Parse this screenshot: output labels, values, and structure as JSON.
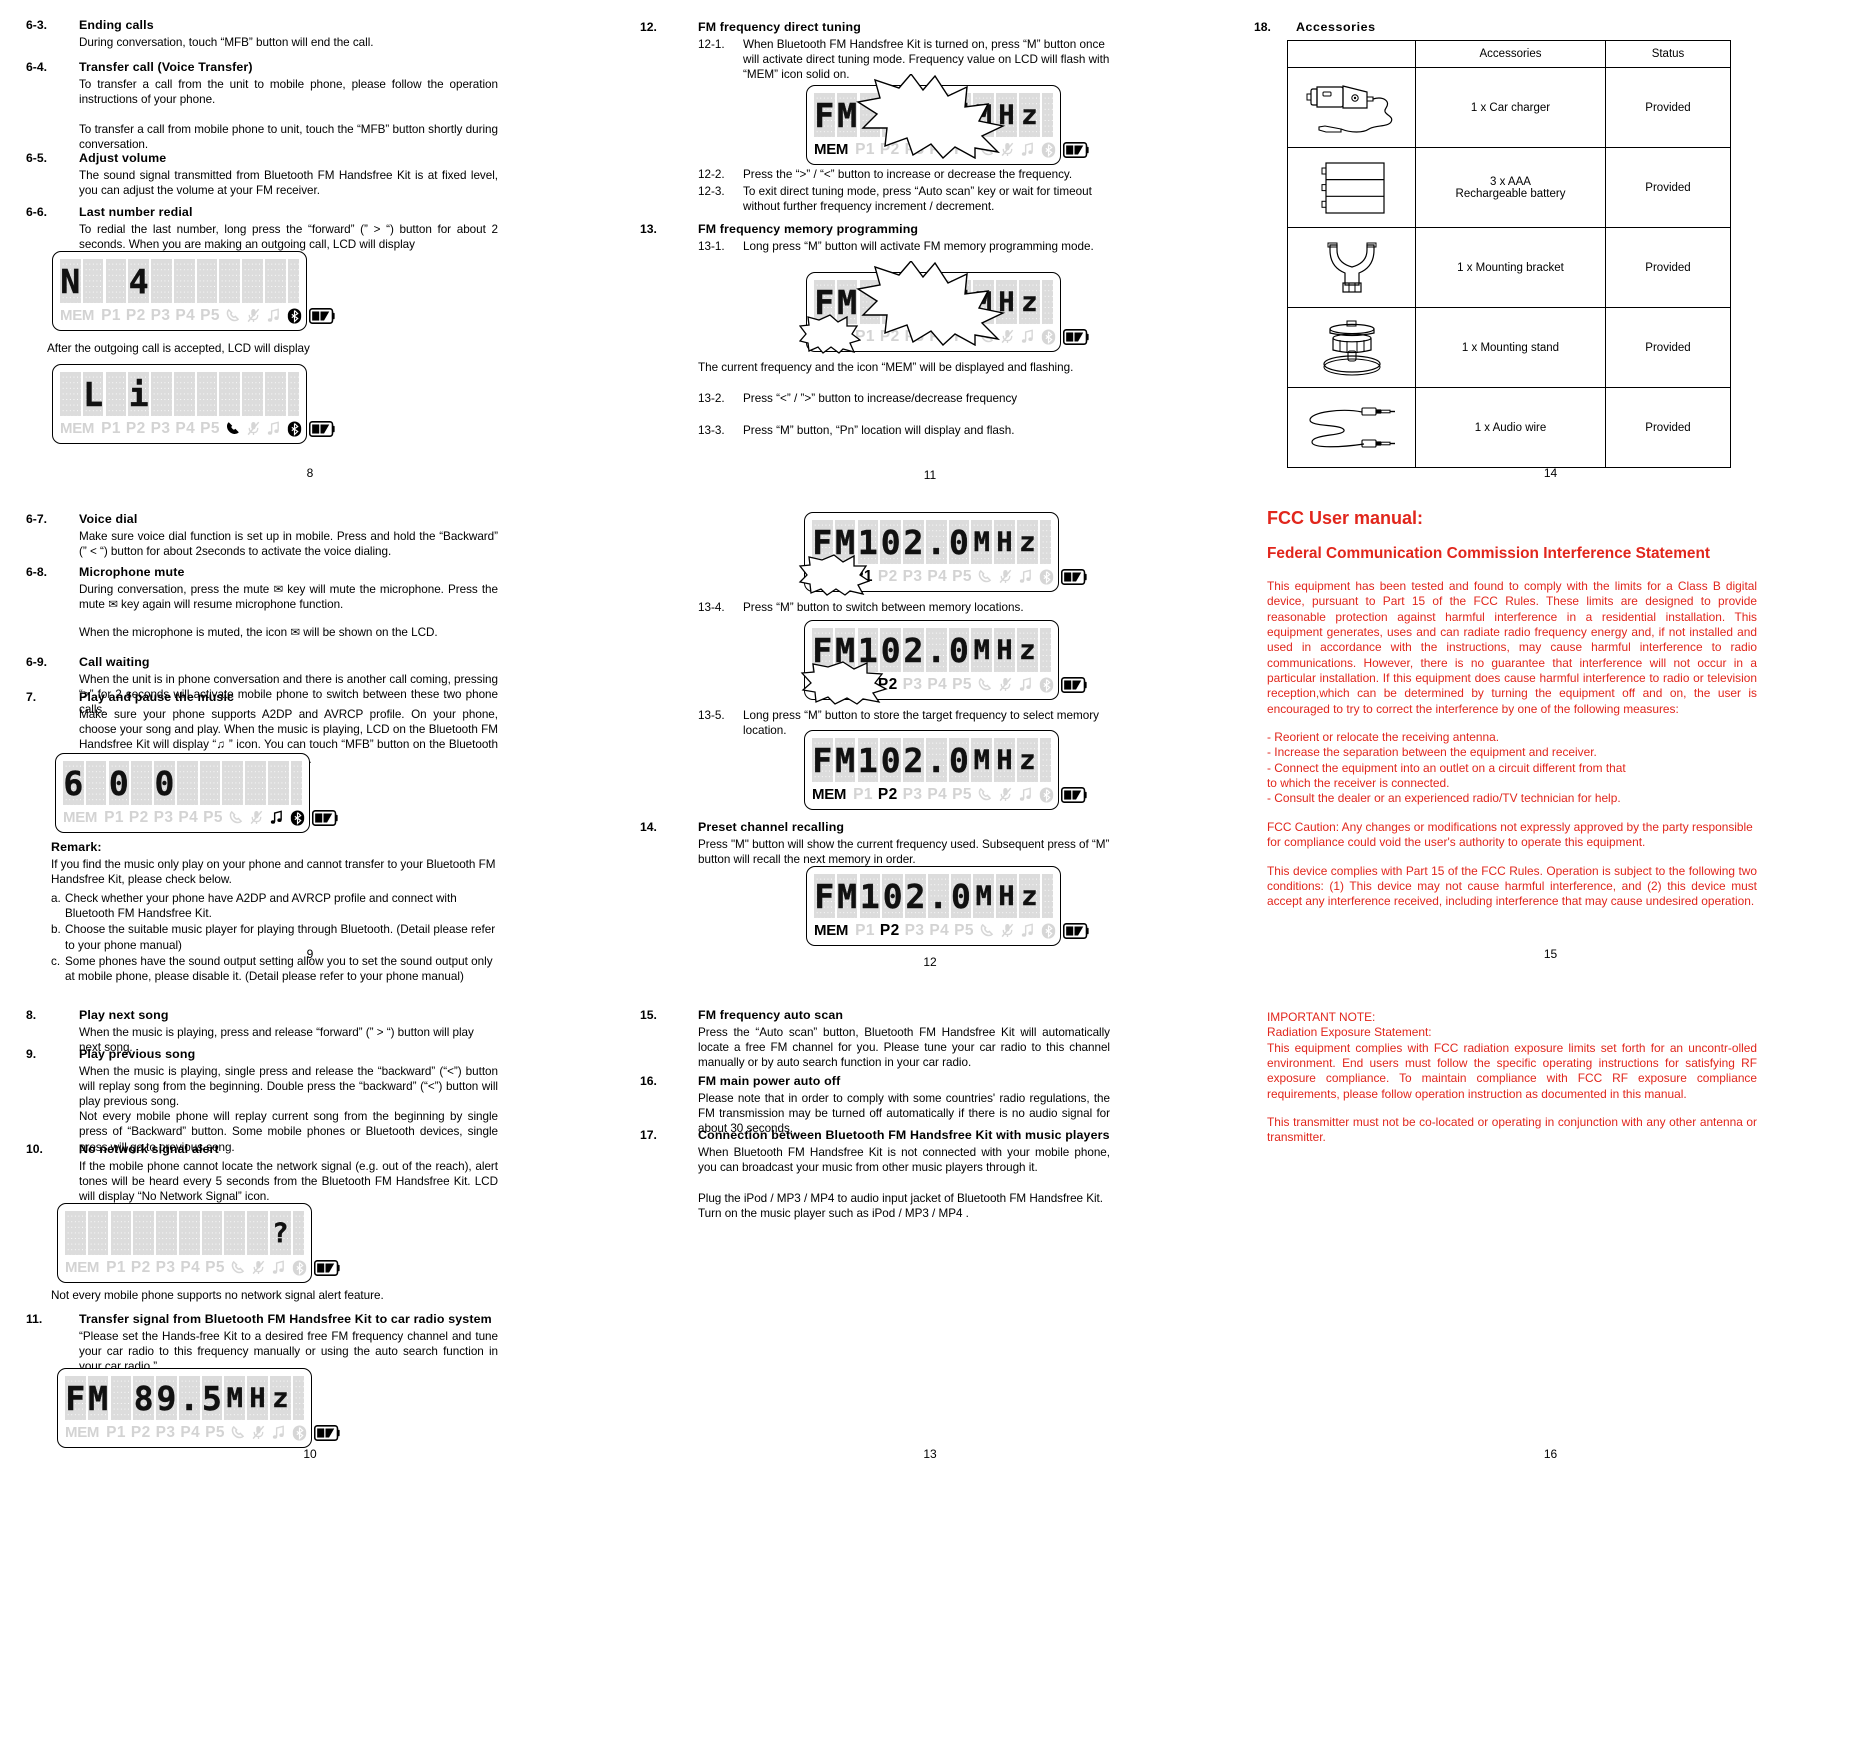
{
  "column1": {
    "sections": [
      {
        "number": "6-3.",
        "title": "Ending calls",
        "paras": [
          "During conversation, touch “MFB” button will end the call."
        ]
      },
      {
        "number": "6-4.",
        "title": "Transfer call (Voice Transfer)",
        "paras": [
          "To transfer a call from the unit to mobile phone, please follow the operation instructions of your phone.",
          "To transfer a call from mobile phone to unit, touch the “MFB” button shortly during conversation."
        ]
      },
      {
        "number": "6-5.",
        "title": "Adjust volume",
        "paras": [
          "The sound signal transmitted from Bluetooth FM Handsfree Kit is at fixed level, you can adjust the volume at your FM receiver."
        ]
      },
      {
        "number": "6-6.",
        "title": "Last number redial",
        "paras": [
          "To redial the last number, long press the “forward” (” > “) button for about 2 seconds. When you are making an outgoing call, LCD will display"
        ],
        "after_lcd_text": "After the outgoing call is accepted, LCD will display"
      },
      {
        "number": "6-7.",
        "title": "Voice dial",
        "paras": [
          "Make sure voice dial function is set up in mobile.  Press and hold the “Backward” (” < “) button for about 2seconds to activate the voice dialing."
        ]
      },
      {
        "number": "6-8.",
        "title": "Microphone mute",
        "paras": [
          "During conversation, press the mute ✉ key will mute the microphone. Press the mute ✉ key again will resume microphone function.",
          "When the microphone is muted, the icon ✉ will be shown on the LCD."
        ]
      },
      {
        "number": "6-9.",
        "title": "Call waiting",
        "paras": [
          "When the unit is in phone conversation and there is another call coming, pressing “>” for 2 seconds will activate mobile phone to switch between these two phone calls."
        ]
      },
      {
        "number": "7.",
        "title": "Play and pause the music",
        "paras": [
          "Make sure your phone supports A2DP and AVRCP profile. On your phone, choose your song and play. When the music is playing, LCD on the Bluetooth FM Handsfree Kit will display “♫ ” icon. You can touch “MFB” button on the Bluetooth FM Handsfree Kit to pause or play the music."
        ],
        "remark_title": "Remark:",
        "remark_intro": "If you find the music only play on your phone and cannot transfer to your Bluetooth FM Handsfree Kit, please check below.",
        "remark_items": [
          {
            "key": "a.",
            "text": "Check whether your phone have A2DP and AVRCP profile and connect with Bluetooth FM Handsfree Kit."
          },
          {
            "key": "b.",
            "text": "Choose the suitable music player for playing through Bluetooth. (Detail please refer to your phone manual)"
          },
          {
            "key": "c.",
            "text": "Some phones have the sound output setting allow you to set the sound output only at mobile phone, please disable it. (Detail please refer to your phone manual)"
          }
        ]
      },
      {
        "number": "8.",
        "title": "Play next song",
        "paras": [
          "When the music is playing, press and release “forward” (” > “) button will play next song."
        ]
      },
      {
        "number": "9.",
        "title": "Play previous song",
        "paras": [
          "When  the music is playing, single  press  and  release  the “backward” (“<”)  button  will replay  song  from  the  beginning.  Double  press  the “backward” (“<”)  button  will  play previous song.",
          "Not  every mobile  phone will  replay  current song from the beginning by single press of “Backward” button.  Some mobile phones  or Bluetooth devices, single  press  will  go to previous song."
        ]
      },
      {
        "number": "10.",
        "title": "No network signal alert",
        "paras": [
          "If the mobile phone cannot locate the  network  signal (e.g. out of the reach), alert tones will be  heard  every 5 seconds  from  the Bluetooth  FM Handsfree Kit.  LCD will display “No Network Signal” icon."
        ],
        "after_lcd_text": "Not every mobile phone supports no network signal alert feature."
      },
      {
        "number": "11.",
        "title": "Transfer signal from Bluetooth FM Handsfree Kit to car radio system",
        "paras": [
          "“Please set the Hands-free Kit to a  desired free FM  frequency  channel  and  tune  your car radio to this frequency manually or using the auto search function in your car radio.”"
        ]
      }
    ],
    "page_numbers": [
      "8",
      "9",
      "10"
    ]
  },
  "column2": {
    "sections": [
      {
        "number": "12.",
        "title": "FM frequency direct tuning",
        "subs": [
          {
            "n": "12-1.",
            "t": "When Bluetooth FM Handsfree Kit is turned on, press “M” button once will activate direct tuning mode.  Frequency value on LCD will flash with “MEM” icon solid on."
          },
          {
            "n": "12-2.",
            "t": "Press the “>” / “<” button to increase or decrease the frequency."
          },
          {
            "n": "12-3.",
            "t": "To exit direct tuning mode, press “Auto scan” key or wait for timeout without further frequency increment / decrement."
          }
        ]
      },
      {
        "number": "13.",
        "title": "FM frequency memory programming",
        "subs": [
          {
            "n": "13-1.",
            "t": "Long press “M” button will activate FM memory programming mode."
          },
          {
            "n": "13-2.",
            "t": "Press “<” / ”>” button to increase/decrease frequency"
          },
          {
            "n": "13-3.",
            "t": "Press “M” button, “Pn” location will display and flash."
          },
          {
            "n": "13-4.",
            "t": "Press “M” button to switch between memory locations."
          },
          {
            "n": "13-5.",
            "t": "Long press “M” button to store the target frequency to select memory location."
          }
        ],
        "note": "The current frequency and the icon “MEM” will be displayed and flashing."
      },
      {
        "number": "14.",
        "title": "Preset channel recalling",
        "paras": [
          "Press \"M\" button will show the current frequency used. Subsequent press of  “M” button will recall the next memory in order."
        ]
      },
      {
        "number": "15.",
        "title": "FM frequency auto scan",
        "paras": [
          "Press the “Auto scan” button, Bluetooth FM Handsfree Kit will automatically locate a free FM  channel  for  you.  Please  tune  your  car  radio  to  this  channel  manually  or  by  auto search function in your car radio."
        ]
      },
      {
        "number": "16.",
        "title": "FM main power auto off",
        "paras": [
          "Please  note  that  in  order  to  comply  with  some  countries'  radio  regulations,  the  FM transmission  may  be  turned  off  automatically  if  there  is  no  audio  signal  for  about  30 seconds."
        ]
      },
      {
        "number": "17.",
        "title": "Connection between Bluetooth FM Handsfree Kit with music players",
        "paras": [
          "When  Bluetooth  FM  Handsfree  Kit  is  not  connected  with  your  mobile  phone,  you  can broadcast your music from other music players through it.",
          "Plug the iPod / MP3 / MP4 to audio input jacket of Bluetooth FM Handsfree Kit.\nTurn on the music player such as iPod / MP3 / MP4 ."
        ]
      }
    ],
    "page_numbers": [
      "11",
      "12",
      "13"
    ]
  },
  "column3": {
    "accessories_section": {
      "number": "18.",
      "title": "Accessories",
      "headers": [
        "",
        "Accessories",
        "Status"
      ],
      "rows": [
        {
          "icon": "car-charger-icon",
          "name": "1 x Car charger",
          "status": "Provided"
        },
        {
          "icon": "aaa-battery-icon",
          "name": "3 x AAA\nRechargeable battery",
          "status": "Provided"
        },
        {
          "icon": "mounting-bracket-icon",
          "name": "1 x Mounting bracket",
          "status": "Provided"
        },
        {
          "icon": "mounting-stand-icon",
          "name": "1 x Mounting stand",
          "status": "Provided"
        },
        {
          "icon": "audio-wire-icon",
          "name": "1 x Audio wire",
          "status": "Provided"
        }
      ]
    },
    "fcc": {
      "title": "FCC User manual:",
      "subtitle": "Federal Communication Commission Interference Statement",
      "para1": "This  equipment  has  been  tested  and found  to comply  with  the  limits for a Class B digital  device,  pursuant  to Part 15  of the FCC Rules.  These  limits  are  designed  to provide reasonable protection  against  harmful interference in a residential installation. This  equipment generates, uses  and  can radiate  radio  frequency  energy and, if not installed and used in accordance with the instructions, may cause harmful interference to radio  communications.  However,  there is no  guarantee that  interference  will  not occur in a particular installation.  If this equipment does  cause harmful  interference to radio or television reception,which can be determined by turning the equipment off and on,  the user is encouraged to try to  correct the  interference  by  one  of the  following measures:",
      "bullets": [
        "- Reorient or relocate the receiving antenna.",
        "- Increase the separation between the equipment and receiver.",
        "- Connect the equipment into an outlet on a circuit different from that",
        "  to which the receiver is connected.",
        "- Consult the dealer or an experienced radio/TV technician for help."
      ],
      "caution": "FCC Caution: Any changes or modifications not expressly approved by the party responsible for compliance could void the user's authority to operate this equipment.",
      "compliance": "This  device  complies  with  Part  15  of  the FCC Rules.  Operation is  subject  to  the following two conditions: (1) This device may not  cause  harmful  interference, and (2) this  device must  accept  any  interference  received, including  interference that  may cause undesired operation.",
      "important_note_title": "IMPORTANT NOTE:",
      "radiation_title": "Radiation Exposure Statement:",
      "radiation_body": "This equipment complies  with FCC radiation exposure limits  set  forth for an uncontr-olled environment.  End  users  must follow   the   specific   operating   instructions  for satisfying  RF exposure compliance. To maintain  compliance  with  FCC RF  exposure compliance  requirements, please  follow  operation  instruction  as documented in this manual.",
      "transmitter": "This  transmitter  must  not be co-located  or operating in  conjunction  with  any  other antenna or transmitter.",
      "color": "#e1261c"
    },
    "page_numbers": [
      "14",
      "15",
      "16"
    ]
  },
  "lcd_displays": [
    {
      "id": "lcd-redial-dialing",
      "text": "N  4",
      "chars": [
        "N",
        "",
        "",
        "4",
        "",
        "",
        "",
        "",
        "",
        ""
      ],
      "mem_on": false,
      "presets_on": [],
      "icons_on": [
        "bluetooth"
      ],
      "battery": true
    },
    {
      "id": "lcd-call-accepted",
      "text": "L  i",
      "chars": [
        "",
        "L",
        "",
        "i",
        "",
        "",
        "",
        "",
        "",
        ""
      ],
      "mem_on": false,
      "presets_on": [],
      "icons_on": [
        "call",
        "bluetooth"
      ],
      "battery": true
    },
    {
      "id": "lcd-music-playing",
      "text": "6 0 0",
      "chars": [
        "6",
        "",
        "0",
        "",
        "0",
        "",
        "",
        "",
        "",
        ""
      ],
      "mem_on": false,
      "presets_on": [],
      "icons_on": [
        "music",
        "bluetooth"
      ],
      "battery": true
    },
    {
      "id": "lcd-no-network",
      "text": "?",
      "chars": [
        "",
        "",
        "",
        "",
        "",
        "",
        "",
        "",
        "",
        "?"
      ],
      "mem_on": false,
      "presets_on": [],
      "icons_on": [],
      "battery": true
    },
    {
      "id": "lcd-fm-89-5",
      "text": "FM  89.5MHz",
      "chars": [
        "F",
        "M",
        "",
        "8",
        "9",
        ".",
        "5",
        "M",
        "H",
        "z"
      ],
      "mem_on": false,
      "presets_on": [],
      "icons_on": [],
      "battery": true
    },
    {
      "id": "lcd-direct-tuning",
      "text": "FM  89.5MHz",
      "chars": [
        "F",
        "M",
        "",
        "8",
        "9",
        ".",
        "5",
        "M",
        "H",
        "z"
      ],
      "mem_on": true,
      "presets_on": [],
      "icons_on": [],
      "battery": true,
      "burst": "freq"
    },
    {
      "id": "lcd-memory-programming",
      "text": "FM  89.5MHz",
      "chars": [
        "F",
        "M",
        "",
        "8",
        "9",
        ".",
        "5",
        "M",
        "H",
        "z"
      ],
      "mem_on": true,
      "presets_on": [],
      "icons_on": [],
      "battery": true,
      "burst": "freq-mem"
    },
    {
      "id": "lcd-mem-p1-flash",
      "text": "FM 102.0MHz",
      "chars": [
        "F",
        "M",
        "1",
        "0",
        "2",
        ".",
        "0",
        "M",
        "H",
        "z"
      ],
      "mem_on": true,
      "presets_on": [
        "P1"
      ],
      "icons_on": [],
      "battery": true,
      "burst": "mem-p1"
    },
    {
      "id": "lcd-mem-p2-flash",
      "text": "FM 102.0MHz",
      "chars": [
        "F",
        "M",
        "1",
        "0",
        "2",
        ".",
        "0",
        "M",
        "H",
        "z"
      ],
      "mem_on": true,
      "presets_on": [
        "P2"
      ],
      "icons_on": [],
      "battery": true,
      "burst": "mem-p2"
    },
    {
      "id": "lcd-mem-p2-stored",
      "text": "FM 102.0MHz",
      "chars": [
        "F",
        "M",
        "1",
        "0",
        "2",
        ".",
        "0",
        "M",
        "H",
        "z"
      ],
      "mem_on": true,
      "presets_on": [
        "P2"
      ],
      "icons_on": [],
      "battery": true
    },
    {
      "id": "lcd-preset-recall",
      "text": "FM 102.0MHz",
      "chars": [
        "F",
        "M",
        "1",
        "0",
        "2",
        ".",
        "0",
        "M",
        "H",
        "z"
      ],
      "mem_on": true,
      "presets_on": [
        "P2"
      ],
      "icons_on": [],
      "battery": true
    }
  ],
  "lcd_status_labels": {
    "mem": "MEM",
    "presets": [
      "P1",
      "P2",
      "P3",
      "P4",
      "P5"
    ],
    "icons": [
      "call-icon",
      "mute-icon",
      "music-icon",
      "bluetooth-icon",
      "battery-icon"
    ]
  }
}
